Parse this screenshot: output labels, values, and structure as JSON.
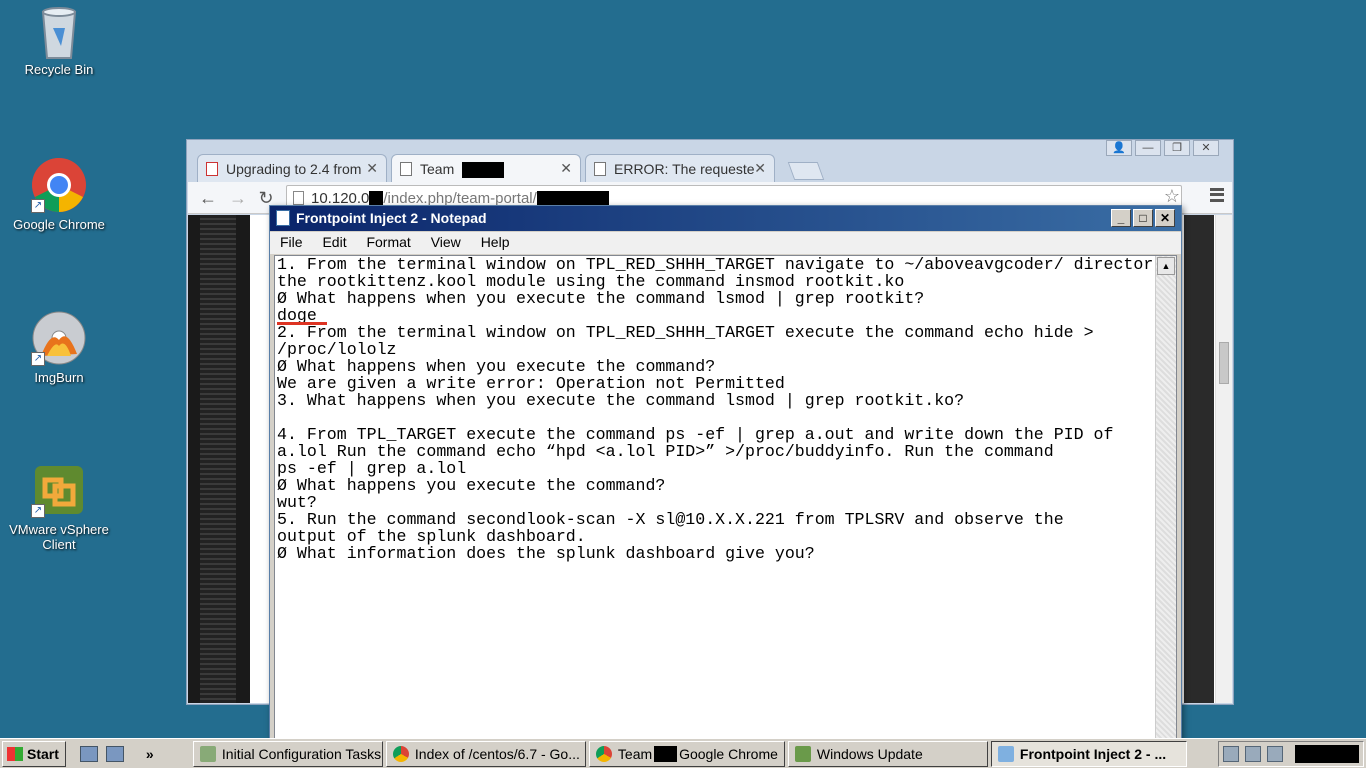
{
  "desktop": {
    "icons": [
      {
        "label": "Recycle Bin"
      },
      {
        "label": "Google Chrome"
      },
      {
        "label": "ImgBurn"
      },
      {
        "label": "VMware vSphere Client"
      }
    ]
  },
  "chrome": {
    "tabs": [
      {
        "label": "Upgrading to 2.4 from"
      },
      {
        "label": "Team"
      },
      {
        "label": "ERROR: The requeste"
      }
    ],
    "url_part1": "10.120.0",
    "url_part2": "/index.php/team-portal/"
  },
  "notepad": {
    "title": "Frontpoint Inject 2 - Notepad",
    "menu": [
      "File",
      "Edit",
      "Format",
      "View",
      "Help"
    ],
    "lines": [
      "1. From the terminal window on TPL_RED_SHHH_TARGET navigate to ~/aboveavgcoder/ director",
      "the rootkittenz.kool module using the command insmod rootkit.ko",
      "Ø What happens when you execute the command lsmod | grep rootkit?",
      "doge",
      "2. From the terminal window on TPL_RED_SHHH_TARGET execute the command echo hide >",
      "/proc/lololz",
      "Ø What happens when you execute the command?",
      "We are given a write error: Operation not Permitted",
      "3. What happens when you execute the command lsmod | grep rootkit.ko?",
      "",
      "4. From TPL_TARGET execute the command ps -ef | grep a.out and write down the PID of",
      "a.lol Run the command echo “hpd <a.lol PID>” >/proc/buddyinfo. Run the command",
      "ps -ef | grep a.lol",
      "Ø What happens you execute the command?",
      "wut?",
      "5. Run the command secondlook-scan -X sl@10.X.X.221 from TPLSRV and observe the",
      "output of the splunk dashboard.",
      "Ø What information does the splunk dashboard give you?"
    ]
  },
  "taskbar": {
    "start": "Start",
    "items": [
      {
        "label": "Initial Configuration Tasks"
      },
      {
        "label": "Index of /centos/6.7 - Go..."
      },
      {
        "label": "Team",
        "suffix": "Google Chrome"
      },
      {
        "label": "Windows Update"
      },
      {
        "label": "Frontpoint Inject 2 - ..."
      }
    ],
    "overflow": "»"
  }
}
